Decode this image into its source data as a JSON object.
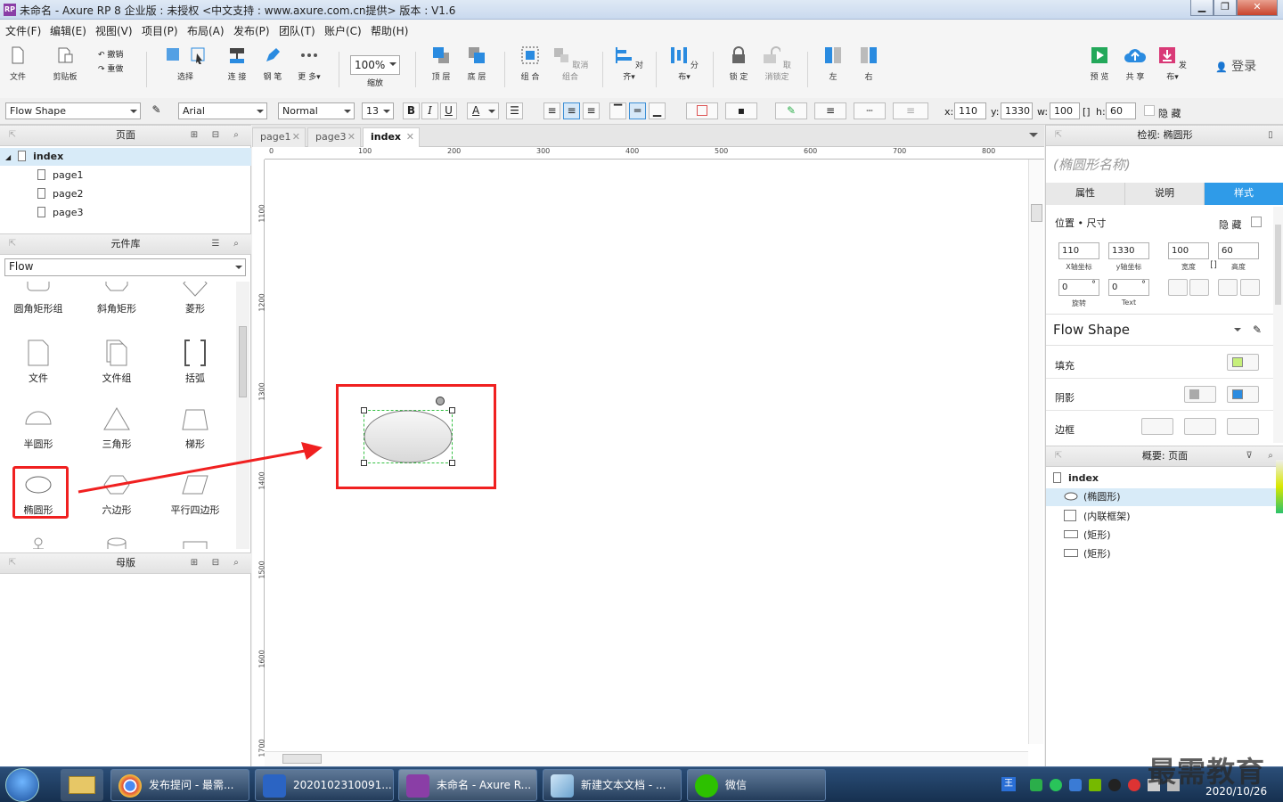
{
  "window": {
    "title": "未命名 - Axure RP 8 企业版 : 未授权     <中文支持 : www.axure.com.cn提供> 版本 : V1.6",
    "logo": "RP"
  },
  "menu": [
    "文件(F)",
    "编辑(E)",
    "视图(V)",
    "项目(P)",
    "布局(A)",
    "发布(P)",
    "团队(T)",
    "账户(C)",
    "帮助(H)"
  ],
  "toolbar": {
    "file": "文件",
    "clipboard": "剪贴板",
    "undo": "撤销",
    "redo": "重做",
    "select": "选择",
    "connect": "连 接",
    "pen": "钢 笔",
    "more": "更 多▾",
    "zoom_value": "100%",
    "zoom": "缩放",
    "top": "顶 层",
    "bottom": "底 层",
    "group": "组 合",
    "ungroup": "取消 组合",
    "align": "对 齐▾",
    "distribute": "分 布▾",
    "lock": "锁 定",
    "unlock": "取消锁定",
    "left": "左",
    "right": "右",
    "preview": "预 览",
    "share": "共 享",
    "publish": "发 布▾",
    "login": "登录"
  },
  "format": {
    "style": "Flow Shape",
    "font": "Arial",
    "weight": "Normal",
    "size": "13",
    "bold": "B",
    "italic": "I",
    "underline": "U",
    "font_color": "A",
    "x_label": "x:",
    "x": "110",
    "y_label": "y:",
    "y": "1330",
    "w_label": "w:",
    "w": "100",
    "h_label": "h:",
    "h": "60",
    "hide": "隐 藏"
  },
  "pages": {
    "title": "页面",
    "root": "index",
    "children": [
      "page1",
      "page2",
      "page3"
    ]
  },
  "library": {
    "title": "元件库",
    "selected": "Flow",
    "items": [
      "圆角矩形组",
      "斜角矩形",
      "菱形",
      "文件",
      "文件组",
      "括弧",
      "半圆形",
      "三角形",
      "梯形",
      "椭圆形",
      "六边形",
      "平行四边形"
    ]
  },
  "masters": {
    "title": "母版"
  },
  "tabs": [
    "page1",
    "page3",
    "index"
  ],
  "ruler": {
    "h": [
      "0",
      "100",
      "200",
      "300",
      "400",
      "500",
      "600",
      "700",
      "800"
    ],
    "v": [
      "1100",
      "1200",
      "1300",
      "1400",
      "1500",
      "1600",
      "1700"
    ]
  },
  "inspector": {
    "title": "检视: 椭圆形",
    "name_placeholder": "(椭圆形名称)",
    "tabs": [
      "属性",
      "说明",
      "样式"
    ],
    "pos_title": "位置 • 尺寸",
    "hide": "隐 藏",
    "x": "110",
    "y": "1330",
    "w": "100",
    "h": "60",
    "x_label": "X轴坐标",
    "y_label": "y轴坐标",
    "w_label": "宽度",
    "h_label": "高度",
    "rot": "0",
    "rot_text": "0",
    "rot_label": "旋转",
    "text_label": "Text",
    "style_name": "Flow Shape",
    "fill": "填充",
    "shadow": "阴影",
    "border": "边框",
    "fill_color": "#c6ef7a",
    "shadow_color": "#2a8be0"
  },
  "outline": {
    "title": "概要: 页面",
    "root": "index",
    "items": [
      "(椭圆形)",
      "(内联框架)",
      "(矩形)",
      "(矩形)"
    ]
  },
  "taskbar": {
    "items": [
      "发布提问 - 最需...",
      "2020102310091...",
      "未命名 - Axure R...",
      "新建文本文档 - ...",
      "微信"
    ],
    "date": "2020/10/26",
    "watermark": "最需教育"
  },
  "colors": {
    "accent": "#2f9be8",
    "highlight": "#f02020"
  }
}
